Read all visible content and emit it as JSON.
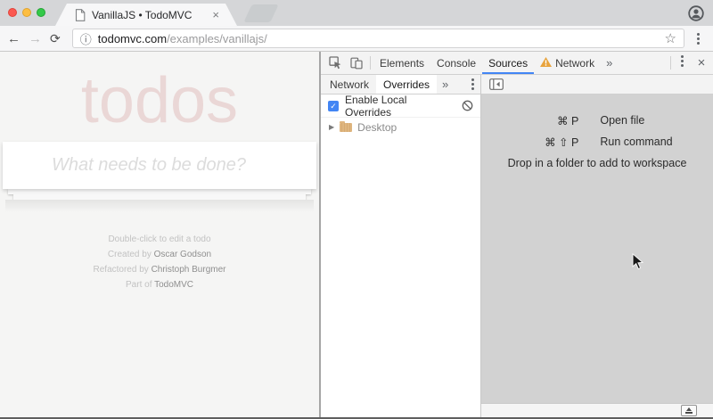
{
  "browser": {
    "tab_title": "VanillaJS • TodoMVC",
    "url_domain": "todomvc.com",
    "url_path": "/examples/vanillajs/",
    "icons": {
      "back": "←",
      "forward": "→",
      "reload": "⟳",
      "info": "ⓘ",
      "star": "☆",
      "tab_close": "×"
    }
  },
  "todo_page": {
    "title": "todos",
    "title_color": "rgba(175,47,47,0.15)",
    "input_placeholder": "What needs to be done?",
    "info_lines": [
      {
        "prefix": "Double-click to edit a todo",
        "emphasis": ""
      },
      {
        "prefix": "Created by ",
        "emphasis": "Oscar Godson"
      },
      {
        "prefix": "Refactored by ",
        "emphasis": "Christoph Burgmer"
      },
      {
        "prefix": "Part of ",
        "emphasis": "TodoMVC"
      }
    ]
  },
  "devtools": {
    "main_tabs": {
      "elements": "Elements",
      "console": "Console",
      "sources": "Sources",
      "network": "Network",
      "overflow": "»",
      "selected": "Sources"
    },
    "close_glyph": "×",
    "sidebar": {
      "tab_network": "Network",
      "tab_overrides": "Overrides",
      "overflow": "»",
      "selected": "Overrides",
      "enable_label": "Enable Local Overrides",
      "check_glyph": "✓",
      "disclosure_glyph": "▶",
      "folder_name": "Desktop"
    },
    "editor": {
      "shortcuts": [
        {
          "keys": "⌘ P",
          "action": "Open file"
        },
        {
          "keys": "⌘ ⇧ P",
          "action": "Run command"
        }
      ],
      "drop_hint": "Drop in a folder to add to workspace"
    },
    "colors": {
      "accent_blue": "#4285f4",
      "warning_orange": "#e8a33d"
    }
  }
}
